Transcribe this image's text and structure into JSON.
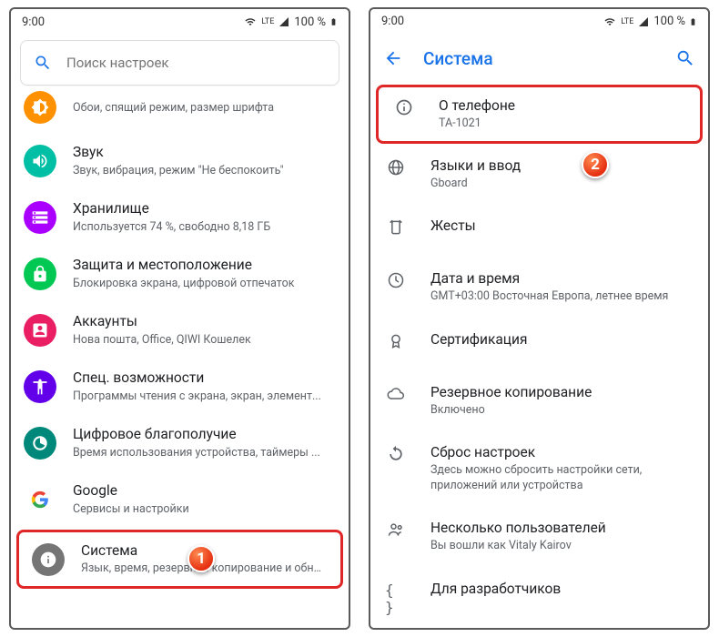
{
  "status": {
    "time": "9:00",
    "battery": "100 %",
    "net": "LTE"
  },
  "left": {
    "search_placeholder": "Поиск настроек",
    "items": [
      {
        "title": "",
        "sub": "Обои, спящий режим, размер шрифта"
      },
      {
        "title": "Звук",
        "sub": "Звук, вибрация, режим \"Не беспокоить\""
      },
      {
        "title": "Хранилище",
        "sub": "Используется 74 %, свободно 8,18 ГБ"
      },
      {
        "title": "Защита и местоположение",
        "sub": "Блокировка экрана, цифровой отпечаток"
      },
      {
        "title": "Аккаунты",
        "sub": "Нова пошта, Office, QIWI Кошелек"
      },
      {
        "title": "Спец. возможности",
        "sub": "Программы чтения с экрана, экран, элемент..."
      },
      {
        "title": "Цифровое благополучие",
        "sub": "Время использования устройства, таймеры ..."
      },
      {
        "title": "Google",
        "sub": "Сервисы и настройки"
      },
      {
        "title": "Система",
        "sub": "Язык, время, резервное копирование и обно..."
      }
    ]
  },
  "right": {
    "header": "Система",
    "items": [
      {
        "title": "О телефоне",
        "sub": "TA-1021"
      },
      {
        "title": "Языки и ввод",
        "sub": "Gboard"
      },
      {
        "title": "Жесты",
        "sub": ""
      },
      {
        "title": "Дата и время",
        "sub": "GMT+03:00 Восточная Европа, летнее время"
      },
      {
        "title": "Сертификация",
        "sub": ""
      },
      {
        "title": "Резервное копирование",
        "sub": "Включено"
      },
      {
        "title": "Сброс настроек",
        "sub": "Здесь можно сбросить настройки сети, приложений или устройства"
      },
      {
        "title": "Несколько пользователей",
        "sub": "Вы вошли как Vitaly Kairov"
      },
      {
        "title": "Для разработчиков",
        "sub": ""
      }
    ]
  },
  "badges": {
    "one": "1",
    "two": "2"
  }
}
